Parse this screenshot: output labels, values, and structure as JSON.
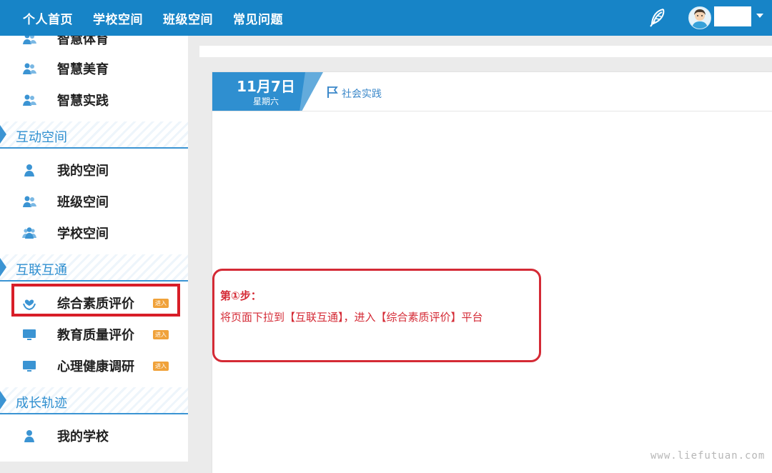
{
  "topnav": {
    "items": [
      "个人首页",
      "学校空间",
      "班级空间",
      "常见问题"
    ]
  },
  "user": {
    "avatar_icon": "user-avatar-icon",
    "menu_icon": "caret-down-icon",
    "theme_icon": "feather-icon"
  },
  "sidebar": {
    "group_top": [
      {
        "label": "智慧体育",
        "icon": "users-icon"
      },
      {
        "label": "智慧美育",
        "icon": "users-icon"
      },
      {
        "label": "智慧实践",
        "icon": "users-icon"
      }
    ],
    "sections": [
      {
        "title": "互动空间",
        "items": [
          {
            "label": "我的空间",
            "icon": "user-icon"
          },
          {
            "label": "班级空间",
            "icon": "users-icon"
          },
          {
            "label": "学校空间",
            "icon": "group-icon"
          }
        ]
      },
      {
        "title": "互联互通",
        "items": [
          {
            "label": "综合素质评价",
            "icon": "heart-hands-icon",
            "badge": "进入"
          },
          {
            "label": "教育质量评价",
            "icon": "monitor-icon",
            "badge": "进入"
          },
          {
            "label": "心理健康调研",
            "icon": "monitor-icon",
            "badge": "进入"
          }
        ]
      },
      {
        "title": "成长轨迹",
        "items": [
          {
            "label": "我的学校",
            "icon": "user-icon"
          }
        ]
      }
    ]
  },
  "post": {
    "date": "11月7日",
    "weekday": "星期六",
    "category": "社会实践",
    "category_icon": "flag-icon"
  },
  "callout": {
    "title": "第①步：",
    "text": "将页面下拉到【互联互通】，进入【综合素质评价】平台"
  },
  "watermark": "www.liefutuan.com",
  "colors": {
    "topbar": "#1784c7",
    "accent": "#3b94d3",
    "highlight": "#d81e28",
    "badge": "#f0a23a"
  }
}
